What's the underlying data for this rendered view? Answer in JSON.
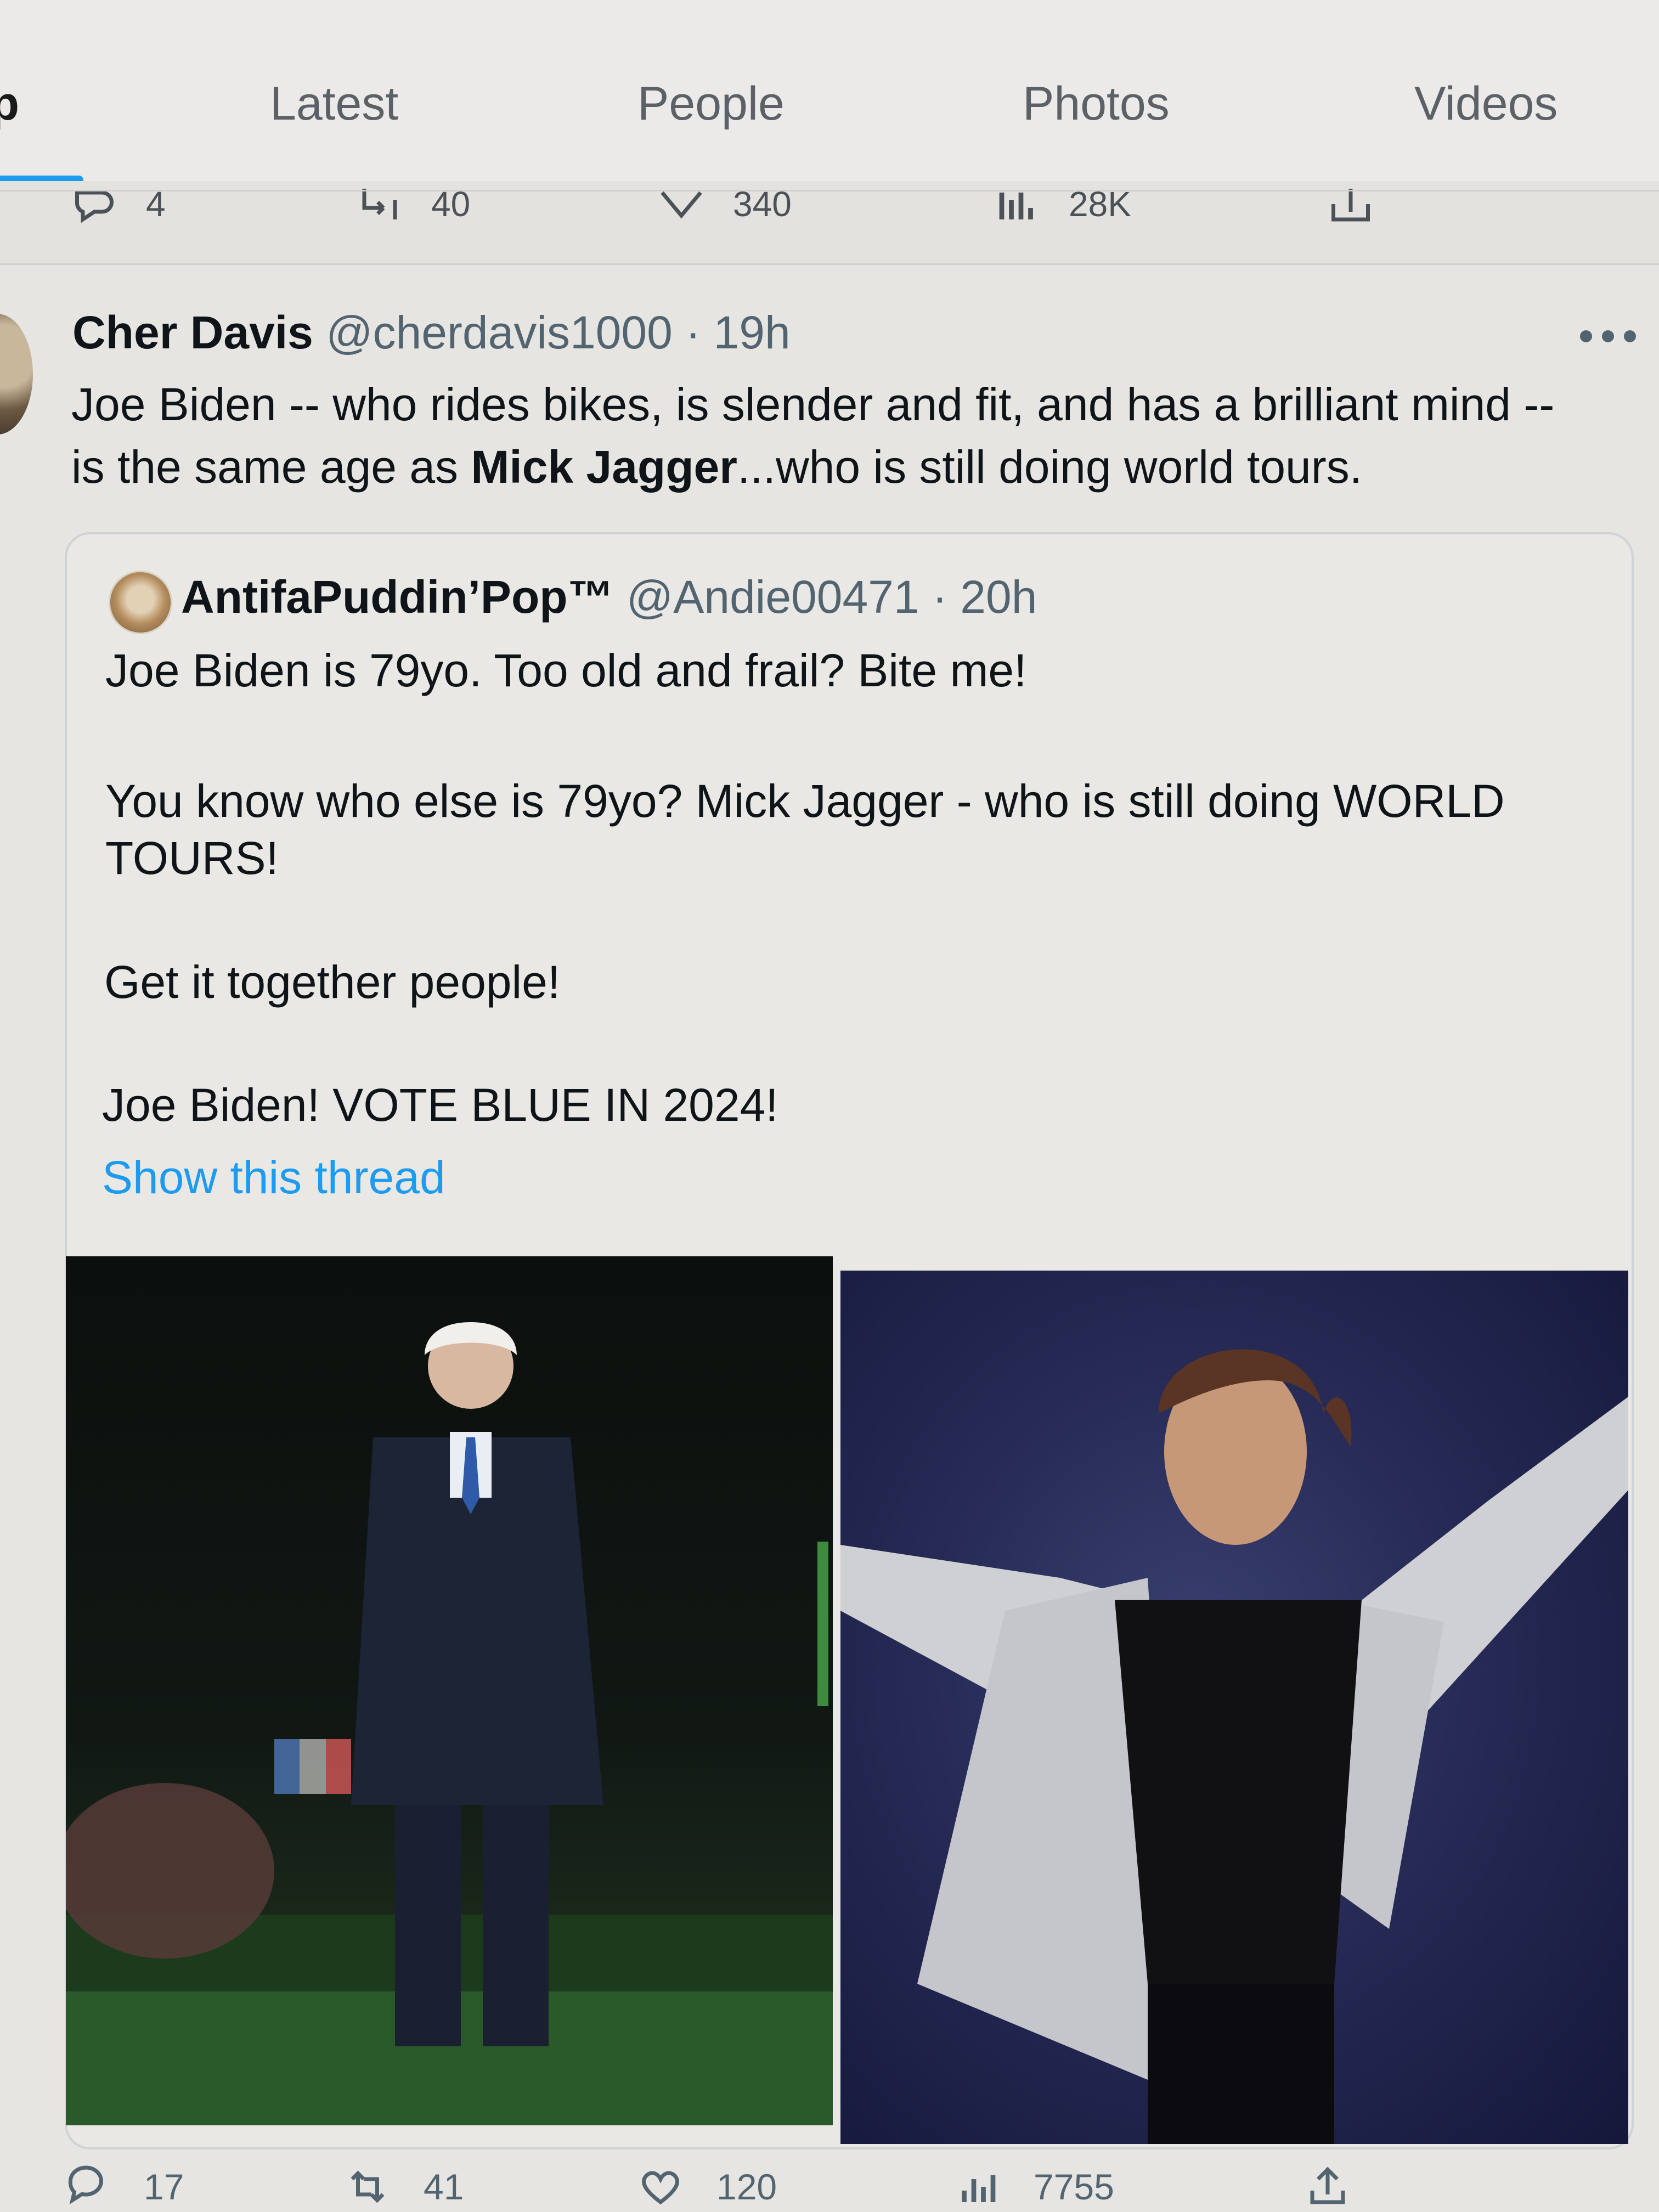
{
  "tabs": {
    "top_partial": "op",
    "latest": "Latest",
    "people": "People",
    "photos": "Photos",
    "videos": "Videos"
  },
  "prev_tweet_actions": {
    "replies": "4",
    "retweets": "40",
    "likes": "340",
    "views": "28K"
  },
  "tweet": {
    "author_name": "Cher Davis",
    "handle": "@cherdavis1000",
    "separator": "·",
    "time": "19h",
    "text_line1": "Joe Biden -- who rides bikes, is slender and fit, and has a brilliant mind --",
    "text_line2_pre": "is the same age as ",
    "text_line2_bold": "Mick Jagger",
    "text_line2_post": "...who is still doing world tours.",
    "actions": {
      "replies": "17",
      "retweets": "41",
      "likes": "120",
      "views": "7755"
    }
  },
  "quote": {
    "author_name": "AntifaPuddin’Pop™",
    "handle": "@Andie00471",
    "separator": "·",
    "time": "20h",
    "line1": "Joe Biden is 79yo. Too old and frail? Bite me!",
    "line2": "You know who else is 79yo? Mick Jagger - who is still doing WORLD",
    "line3": "TOURS!",
    "line4": "Get it together people!",
    "line5": "Joe Biden! VOTE BLUE IN 2024!",
    "show_thread": "Show this thread"
  },
  "icons": {
    "reply": "reply-icon",
    "retweet": "retweet-icon",
    "like": "heart-icon",
    "views": "views-icon",
    "share": "share-icon",
    "more": "more-icon"
  },
  "colors": {
    "accent": "#1d9bf0",
    "text": "#0f1419",
    "secondary": "#536471"
  }
}
